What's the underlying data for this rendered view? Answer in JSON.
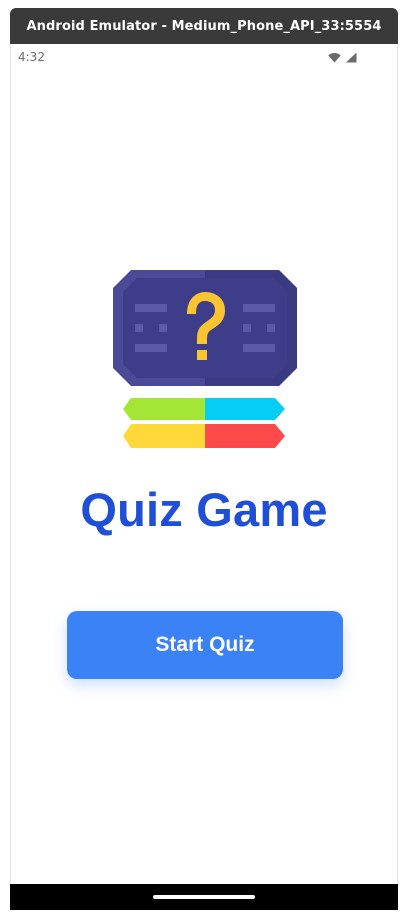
{
  "window": {
    "title": "Android Emulator - Medium_Phone_API_33:5554"
  },
  "statusbar": {
    "time": "4:32",
    "icons": [
      "wifi-icon",
      "signal-icon"
    ]
  },
  "app": {
    "logo_icon": "quiz-question-icon",
    "title": "Quiz Game",
    "start_button_label": "Start Quiz"
  },
  "colors": {
    "title": "#1e4fd6",
    "button": "#3b82f6",
    "logo_dark": "#3f3f87",
    "logo_question": "#fbc531",
    "stripe_green": "#a3e635",
    "stripe_cyan": "#06cdf4",
    "stripe_yellow": "#ffd83a",
    "stripe_red": "#ff4a4a"
  },
  "navigation": {
    "home_indicator": "home-handle"
  }
}
